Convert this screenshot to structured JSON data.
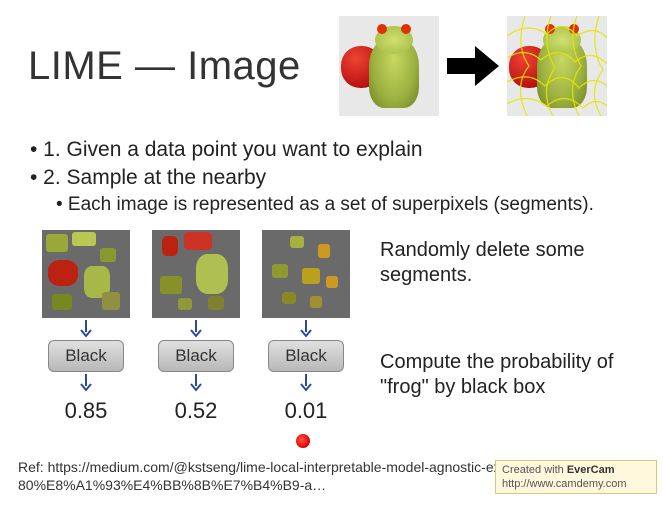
{
  "title": "LIME — Image",
  "bullets": {
    "b1": "• 1. Given a data point you want to explain",
    "b2": "• 2. Sample at the nearby",
    "b3": "• Each image is represented as a set of superpixels (segments)."
  },
  "blackbox_label": "Black",
  "examples": [
    {
      "prob": "0.85"
    },
    {
      "prob": "0.52"
    },
    {
      "prob": "0.01"
    }
  ],
  "side": {
    "t1": "Randomly delete some segments.",
    "t2": "Compute the probability of \"frog\" by black box"
  },
  "ref": "Ref: https://medium.com/@kstseng/lime-local-interpretable-model-agnostic-explanation-%E6%8A%80%E8%A1%93%E4%BB%8B%E7%B4%B9-a…",
  "watermark": {
    "line1_a": "Created with ",
    "line1_b": "EverCam",
    "line2": "http://www.camdemy.com"
  }
}
